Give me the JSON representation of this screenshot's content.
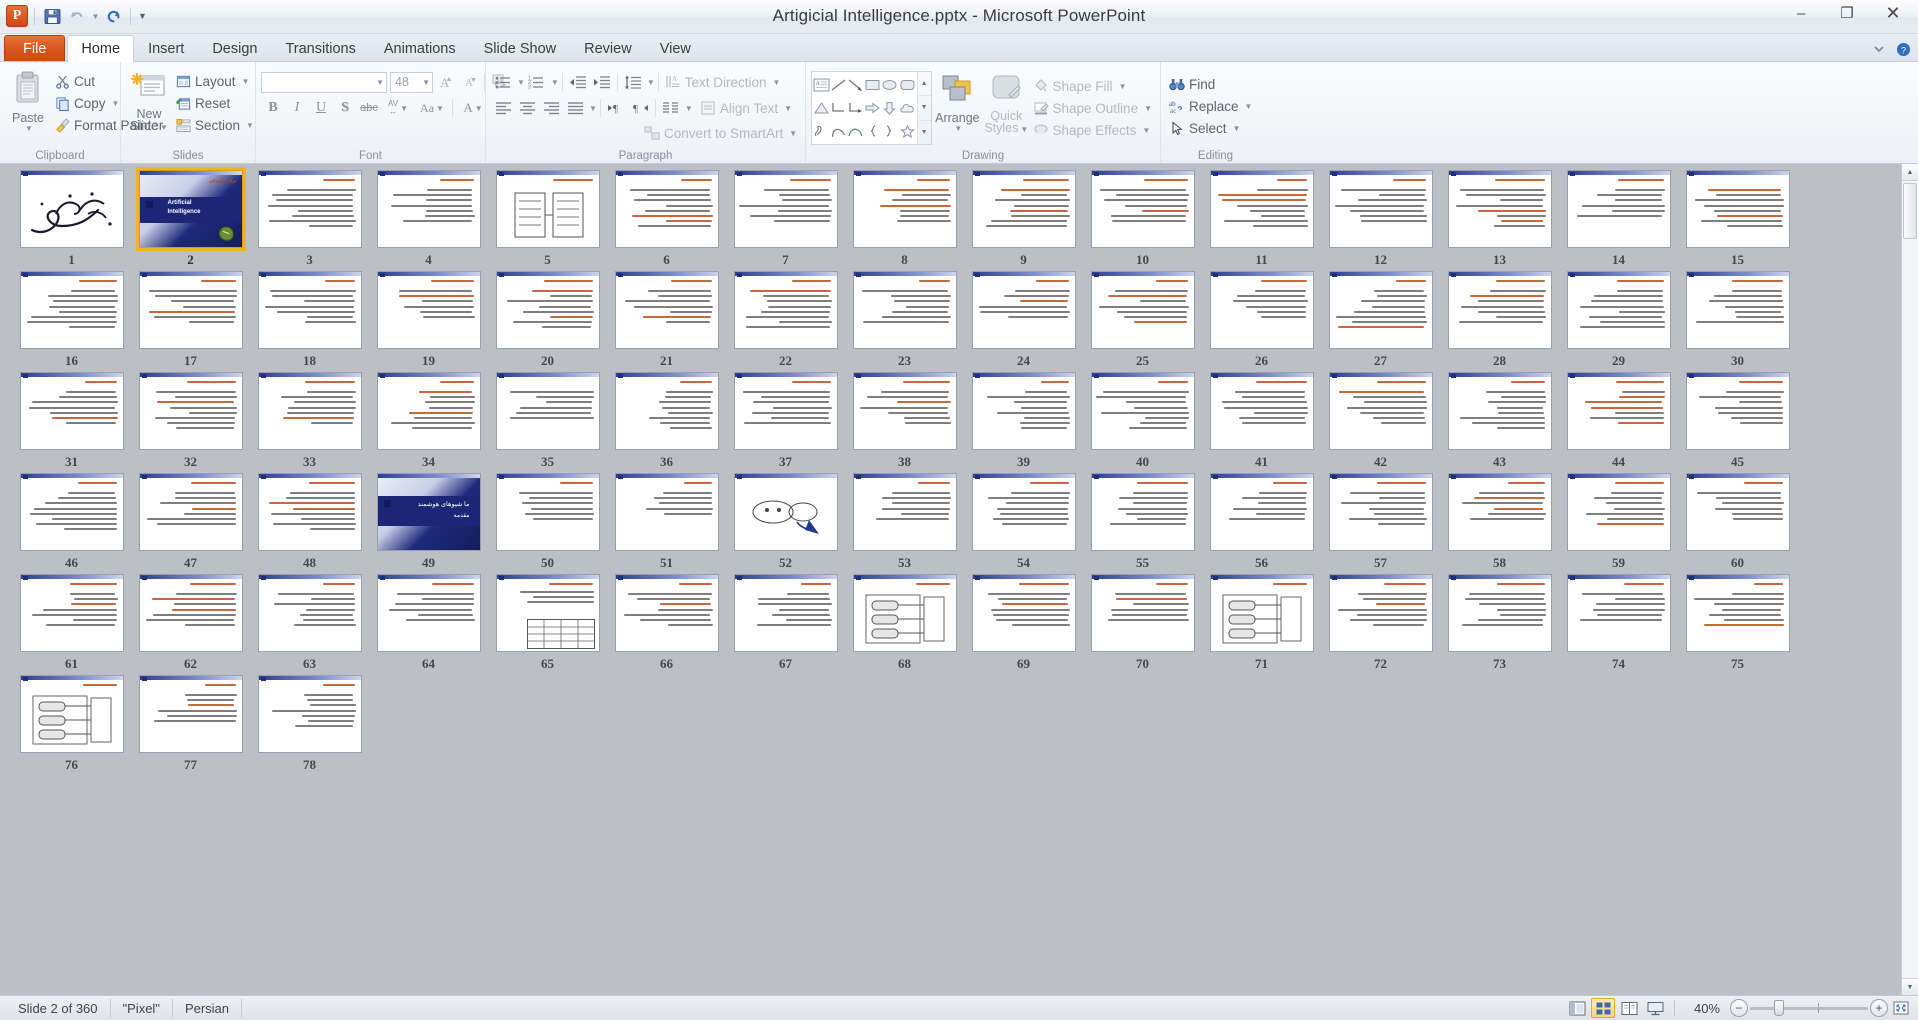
{
  "window": {
    "title": "Artigicial Intelligence.pptx  -  Microsoft PowerPoint",
    "minimize": "–",
    "restore": "❐",
    "close": "✕"
  },
  "quick_access": {
    "logo": "P",
    "items": [
      {
        "name": "save-icon",
        "label": "Save"
      },
      {
        "name": "undo-icon",
        "label": "Undo"
      },
      {
        "name": "redo-icon",
        "label": "Redo"
      },
      {
        "name": "customize-qat-icon",
        "label": "Customize Quick Access Toolbar"
      }
    ]
  },
  "tabs": [
    {
      "label": "File",
      "type": "file"
    },
    {
      "label": "Home",
      "type": "active"
    },
    {
      "label": "Insert",
      "type": "normal"
    },
    {
      "label": "Design",
      "type": "normal"
    },
    {
      "label": "Transitions",
      "type": "normal"
    },
    {
      "label": "Animations",
      "type": "normal"
    },
    {
      "label": "Slide Show",
      "type": "normal"
    },
    {
      "label": "Review",
      "type": "normal"
    },
    {
      "label": "View",
      "type": "normal"
    }
  ],
  "ribbon": {
    "groups": [
      {
        "label": "Clipboard"
      },
      {
        "label": "Slides"
      },
      {
        "label": "Font"
      },
      {
        "label": "Paragraph"
      },
      {
        "label": "Drawing"
      },
      {
        "label": "Editing"
      }
    ],
    "clipboard": {
      "paste": "Paste",
      "cut": "Cut",
      "copy": "Copy",
      "format_painter": "Format Painter"
    },
    "slides": {
      "new_slide": "New\nSlide",
      "new_slide_line1": "New",
      "new_slide_line2": "Slide",
      "layout": "Layout",
      "reset": "Reset",
      "section": "Section"
    },
    "font": {
      "font_name": "",
      "font_name_placeholder": "",
      "font_size": "48",
      "bold": "B",
      "italic": "I",
      "underline": "U",
      "shadow": "S",
      "strikethrough": "abc",
      "character_spacing": "AV",
      "change_case": "Aa",
      "font_color": "A",
      "grow_font": "A",
      "shrink_font": "A",
      "clear_formatting": "Aa"
    },
    "paragraph": {
      "text_direction": "Text Direction",
      "align_text": "Align Text",
      "convert_to_smartart": "Convert to SmartArt"
    },
    "drawing": {
      "arrange": "Arrange",
      "quick_styles_line1": "Quick",
      "quick_styles_line2": "Styles",
      "shape_fill": "Shape Fill",
      "shape_outline": "Shape Outline",
      "shape_effects": "Shape Effects"
    },
    "editing": {
      "find": "Find",
      "replace": "Replace",
      "select": "Select"
    }
  },
  "statusbar": {
    "slide_counter": "Slide 2 of 360",
    "theme": "\"Pixel\"",
    "language": "Persian",
    "zoom_level": "40%",
    "views": [
      {
        "name": "normal-view-button",
        "label": "Normal",
        "active": false
      },
      {
        "name": "slide-sorter-view-button",
        "label": "Slide Sorter",
        "active": true
      },
      {
        "name": "reading-view-button",
        "label": "Reading View",
        "active": false
      },
      {
        "name": "slide-show-button",
        "label": "Slide Show",
        "active": false
      }
    ],
    "zoom_out": "−",
    "zoom_in": "+",
    "fit_to_window": "Fit slide to current window"
  },
  "slides": {
    "selected": 2,
    "total_shown": 78,
    "title_slide_text_line1": "Artificial",
    "title_slide_text_line2": "Intelligence",
    "section_slide_text": "مقدمه",
    "items": [
      {
        "n": 1,
        "kind": "calligraphy"
      },
      {
        "n": 2,
        "kind": "title",
        "selected": true
      },
      {
        "n": 3,
        "kind": "text",
        "lines": 8,
        "title": true
      },
      {
        "n": 4,
        "kind": "text",
        "lines": 7,
        "title": true
      },
      {
        "n": 5,
        "kind": "diagram"
      },
      {
        "n": 6,
        "kind": "text",
        "lines": 8,
        "title": true
      },
      {
        "n": 7,
        "kind": "text",
        "lines": 7,
        "title": true
      },
      {
        "n": 8,
        "kind": "text",
        "lines": 7,
        "title": true
      },
      {
        "n": 9,
        "kind": "text",
        "lines": 8,
        "title": true
      },
      {
        "n": 10,
        "kind": "text",
        "lines": 7,
        "title": true
      },
      {
        "n": 11,
        "kind": "text",
        "lines": 8,
        "title": true
      },
      {
        "n": 12,
        "kind": "text",
        "lines": 7,
        "title": true
      },
      {
        "n": 13,
        "kind": "text",
        "lines": 8,
        "title": true
      },
      {
        "n": 14,
        "kind": "text",
        "lines": 6,
        "title": true
      },
      {
        "n": 15,
        "kind": "text",
        "lines": 8,
        "title": false
      },
      {
        "n": 16,
        "kind": "text",
        "lines": 8,
        "title": true
      },
      {
        "n": 17,
        "kind": "text",
        "lines": 7,
        "title": true
      },
      {
        "n": 18,
        "kind": "text",
        "lines": 7,
        "title": true
      },
      {
        "n": 19,
        "kind": "text",
        "lines": 6,
        "title": true
      },
      {
        "n": 20,
        "kind": "text",
        "lines": 8,
        "title": true
      },
      {
        "n": 21,
        "kind": "text",
        "lines": 7,
        "title": true
      },
      {
        "n": 22,
        "kind": "text",
        "lines": 8,
        "title": true
      },
      {
        "n": 23,
        "kind": "text",
        "lines": 7,
        "title": true
      },
      {
        "n": 24,
        "kind": "text",
        "lines": 6,
        "title": true
      },
      {
        "n": 25,
        "kind": "text",
        "lines": 7,
        "title": true
      },
      {
        "n": 26,
        "kind": "text",
        "lines": 6,
        "title": true
      },
      {
        "n": 27,
        "kind": "text",
        "lines": 8,
        "title": true
      },
      {
        "n": 28,
        "kind": "text",
        "lines": 7,
        "title": true
      },
      {
        "n": 29,
        "kind": "text",
        "lines": 8,
        "title": true
      },
      {
        "n": 30,
        "kind": "text",
        "lines": 7,
        "title": true
      },
      {
        "n": 31,
        "kind": "text",
        "lines": 7,
        "title": true
      },
      {
        "n": 32,
        "kind": "text",
        "lines": 8,
        "title": true
      },
      {
        "n": 33,
        "kind": "text",
        "lines": 7,
        "title": true
      },
      {
        "n": 34,
        "kind": "text",
        "lines": 8,
        "title": true
      },
      {
        "n": 35,
        "kind": "text",
        "lines": 6,
        "title": false
      },
      {
        "n": 36,
        "kind": "text",
        "lines": 8,
        "title": true
      },
      {
        "n": 37,
        "kind": "text",
        "lines": 7,
        "title": true
      },
      {
        "n": 38,
        "kind": "text",
        "lines": 7,
        "title": true
      },
      {
        "n": 39,
        "kind": "text",
        "lines": 8,
        "title": true
      },
      {
        "n": 40,
        "kind": "text",
        "lines": 8,
        "title": true
      },
      {
        "n": 41,
        "kind": "text",
        "lines": 7,
        "title": true
      },
      {
        "n": 42,
        "kind": "text",
        "lines": 7,
        "title": true
      },
      {
        "n": 43,
        "kind": "text",
        "lines": 8,
        "title": true
      },
      {
        "n": 44,
        "kind": "text",
        "lines": 7,
        "title": true
      },
      {
        "n": 45,
        "kind": "text",
        "lines": 7,
        "title": true
      },
      {
        "n": 46,
        "kind": "text",
        "lines": 8,
        "title": true
      },
      {
        "n": 47,
        "kind": "text",
        "lines": 7,
        "title": true
      },
      {
        "n": 48,
        "kind": "text",
        "lines": 8,
        "title": true
      },
      {
        "n": 49,
        "kind": "section"
      },
      {
        "n": 50,
        "kind": "text",
        "lines": 6,
        "title": true
      },
      {
        "n": 51,
        "kind": "text",
        "lines": 5,
        "title": true
      },
      {
        "n": 52,
        "kind": "figure"
      },
      {
        "n": 53,
        "kind": "text",
        "lines": 6,
        "title": true
      },
      {
        "n": 54,
        "kind": "text",
        "lines": 7,
        "title": true
      },
      {
        "n": 55,
        "kind": "text",
        "lines": 7,
        "title": true
      },
      {
        "n": 56,
        "kind": "text",
        "lines": 6,
        "title": true
      },
      {
        "n": 57,
        "kind": "text",
        "lines": 7,
        "title": true
      },
      {
        "n": 58,
        "kind": "text",
        "lines": 6,
        "title": true
      },
      {
        "n": 59,
        "kind": "text",
        "lines": 7,
        "title": true
      },
      {
        "n": 60,
        "kind": "text",
        "lines": 6,
        "title": true
      },
      {
        "n": 61,
        "kind": "text",
        "lines": 7,
        "title": true
      },
      {
        "n": 62,
        "kind": "text",
        "lines": 7,
        "title": true
      },
      {
        "n": 63,
        "kind": "text",
        "lines": 7,
        "title": true
      },
      {
        "n": 64,
        "kind": "text",
        "lines": 6,
        "title": true
      },
      {
        "n": 65,
        "kind": "table"
      },
      {
        "n": 66,
        "kind": "text",
        "lines": 7,
        "title": true
      },
      {
        "n": 67,
        "kind": "text",
        "lines": 7,
        "title": true
      },
      {
        "n": 68,
        "kind": "flow"
      },
      {
        "n": 69,
        "kind": "text",
        "lines": 7,
        "title": true
      },
      {
        "n": 70,
        "kind": "text",
        "lines": 6,
        "title": true
      },
      {
        "n": 71,
        "kind": "flow"
      },
      {
        "n": 72,
        "kind": "text",
        "lines": 7,
        "title": true
      },
      {
        "n": 73,
        "kind": "text",
        "lines": 7,
        "title": true
      },
      {
        "n": 74,
        "kind": "text",
        "lines": 6,
        "title": true
      },
      {
        "n": 75,
        "kind": "text",
        "lines": 7,
        "title": true
      },
      {
        "n": 76,
        "kind": "flow"
      },
      {
        "n": 77,
        "kind": "text",
        "lines": 6,
        "title": true
      },
      {
        "n": 78,
        "kind": "text",
        "lines": 7,
        "title": true
      }
    ]
  },
  "colors": {
    "accent_orange": "#d8561d",
    "selection_gold": "#f0b323",
    "slide_navy": "#1b2676",
    "sorter_background": "#bcc0c6"
  }
}
